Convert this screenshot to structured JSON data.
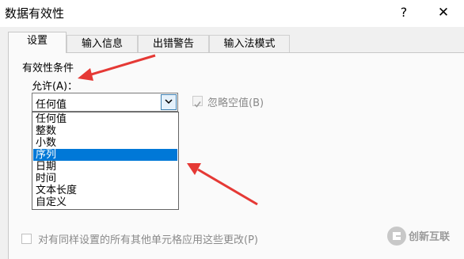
{
  "window": {
    "title": "数据有效性",
    "help": "?",
    "close": "✕"
  },
  "tabs": [
    {
      "label": "设置",
      "active": true
    },
    {
      "label": "输入信息",
      "active": false
    },
    {
      "label": "出错警告",
      "active": false
    },
    {
      "label": "输入法模式",
      "active": false
    }
  ],
  "settings": {
    "group_label": "有效性条件",
    "allow_label": "允许(A)：",
    "allow_value": "任何值",
    "options": [
      "任何值",
      "整数",
      "小数",
      "序列",
      "日期",
      "时间",
      "文本长度",
      "自定义"
    ],
    "selected_option_index": 3,
    "ignore_blank_label": "忽略空值(B)",
    "ignore_blank_checked": true,
    "apply_all_label": "对有同样设置的所有其他单元格应用这些更改(P)",
    "apply_all_checked": false
  },
  "watermark": {
    "text": "创新互联"
  },
  "colors": {
    "highlight": "#0078d7",
    "annotation_arrow": "#e53935"
  }
}
